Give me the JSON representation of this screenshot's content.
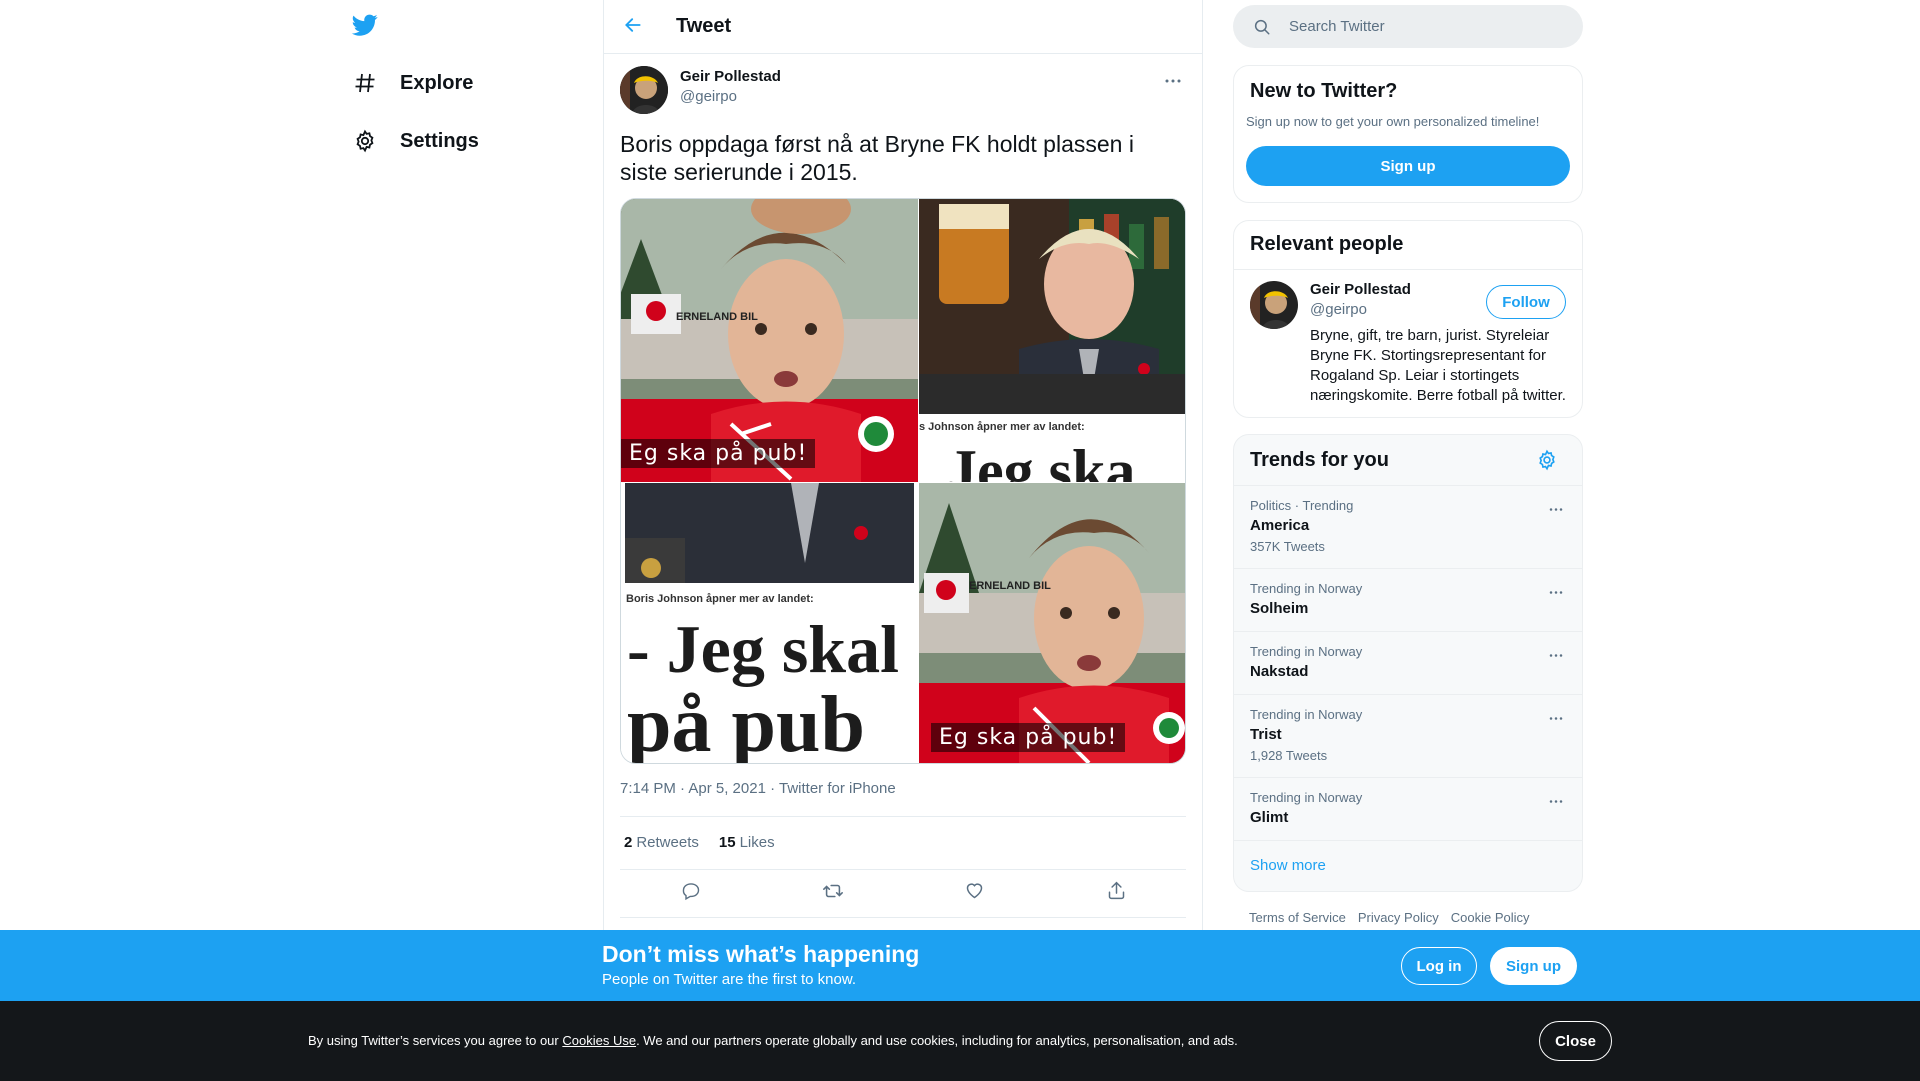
{
  "brand": {
    "accent": "#1da1f2",
    "logo_icon": "twitter-bird-icon"
  },
  "nav": {
    "items": [
      {
        "label": "Explore",
        "icon": "hashtag-icon"
      },
      {
        "label": "Settings",
        "icon": "gear-icon"
      }
    ]
  },
  "header": {
    "title": "Tweet",
    "back_icon": "arrow-left-icon"
  },
  "tweet": {
    "author_name": "Geir Pollestad",
    "author_handle": "@geirpo",
    "text": "Boris oppdaga først nå at Bryne FK holdt plassen i siste serierunde i 2015.",
    "media": {
      "caption_top": "Eg ska på pub!",
      "caption_bottom": "Eg ska på pub!",
      "headline_small_top": "s Johnson åpner mer av landet:",
      "headline_big_top": "Jeg ska",
      "headline_small_bottom": "Boris Johnson åpner mer av landet:",
      "headline_big_line1": "- Jeg skal",
      "headline_big_line2": "på pub",
      "banner_text": "ERNELAND BIL"
    },
    "meta": "7:14 PM · Apr 5, 2021 · Twitter for iPhone",
    "retweets_count": "2",
    "retweets_label": "Retweets",
    "likes_count": "15",
    "likes_label": "Likes"
  },
  "search": {
    "placeholder": "Search Twitter"
  },
  "new_to_twitter": {
    "title": "New to Twitter?",
    "subtitle": "Sign up now to get your own personalized timeline!",
    "button": "Sign up"
  },
  "relevant_people": {
    "title": "Relevant people",
    "name": "Geir Pollestad",
    "handle": "@geirpo",
    "follow": "Follow",
    "bio": "Bryne, gift, tre barn, jurist. Styreleiar Bryne FK. Stortingsrepresentant for Rogaland Sp. Leiar i stortingets næringskomite. Berre fotball på twitter."
  },
  "trends": {
    "title": "Trends for you",
    "items": [
      {
        "context": "Politics · Trending",
        "name": "America",
        "count": "357K Tweets"
      },
      {
        "context": "Trending in Norway",
        "name": "Solheim",
        "count": ""
      },
      {
        "context": "Trending in Norway",
        "name": "Nakstad",
        "count": ""
      },
      {
        "context": "Trending in Norway",
        "name": "Trist",
        "count": "1,928 Tweets"
      },
      {
        "context": "Trending in Norway",
        "name": "Glimt",
        "count": ""
      }
    ],
    "show_more": "Show more"
  },
  "footer": {
    "terms": "Terms of Service",
    "privacy": "Privacy Policy",
    "cookie": "Cookie Policy"
  },
  "signup_bar": {
    "heading": "Don’t miss what’s happening",
    "subheading": "People on Twitter are the first to know.",
    "login": "Log in",
    "signup": "Sign up"
  },
  "cookie_bar": {
    "text_before": "By using Twitter’s services you agree to our ",
    "link": "Cookies Use",
    "text_after": ". We and our partners operate globally and use cookies, including for analytics, personalisation, and ads.",
    "close": "Close"
  }
}
